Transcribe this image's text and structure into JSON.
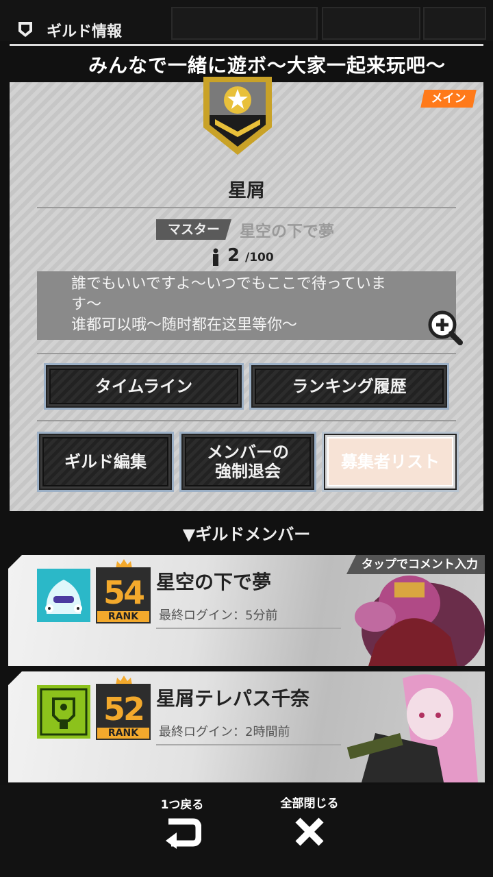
{
  "header": {
    "title": "ギルド情報"
  },
  "guild": {
    "slogan": "みんなで一緒に遊ボ〜大家一起来玩吧〜",
    "main_tag": "メイン",
    "name": "星屑",
    "master_label": "マスター",
    "master_name": "星空の下で夢",
    "members_current": "2",
    "members_max": "/100",
    "comment_line1": "誰でもいいですよ〜いつでもここで待っていま",
    "comment_line2": "す〜",
    "comment_line3": "谁都可以哦〜随时都在这里等你〜"
  },
  "buttons": {
    "timeline": "タイムライン",
    "ranking_history": "ランキング履歴",
    "guild_edit": "ギルド編集",
    "kick_line1": "メンバーの",
    "kick_line2": "強制退会",
    "applicant_list": "募集者リスト"
  },
  "members_section": {
    "title": "▼ギルドメンバー",
    "tap_hint": "タップでコメント入力"
  },
  "members": [
    {
      "name": "星空の下で夢",
      "rank": "54",
      "rank_label": "RANK",
      "last_login": "最終ログイン：5分前"
    },
    {
      "name": "星屑テレパス千奈",
      "rank": "52",
      "rank_label": "RANK",
      "last_login": "最終ログイン：2時間前"
    }
  ],
  "controls": {
    "back_label": "1つ戻る",
    "close_all_label": "全部閉じる"
  },
  "colors": {
    "main_tag": "#ff7a1a",
    "rank_gold": "#f3a92c",
    "button_border": "#9cb0c6"
  }
}
